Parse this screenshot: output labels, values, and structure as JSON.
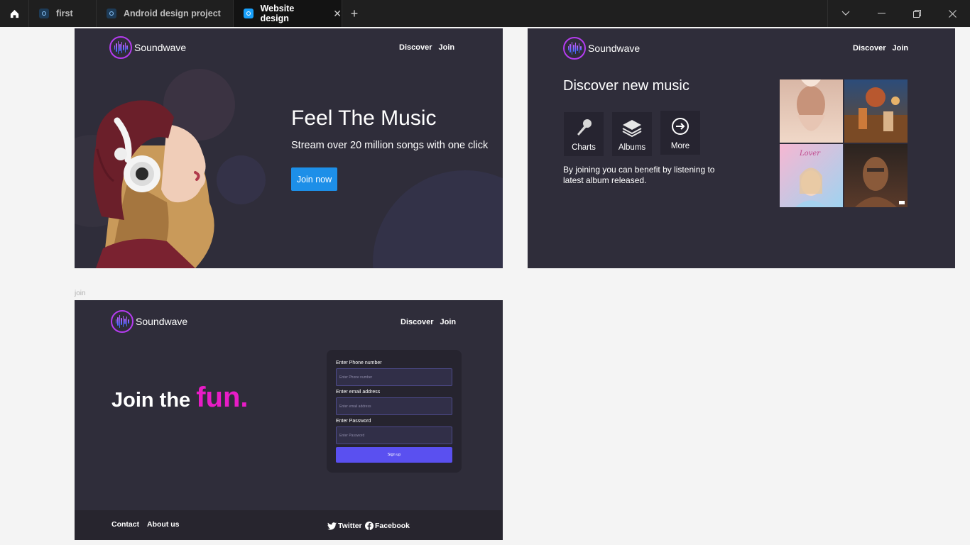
{
  "tabs": [
    {
      "label": "first"
    },
    {
      "label": "Android design project"
    },
    {
      "label": "Website design"
    }
  ],
  "new_tab_label": "+",
  "icons": [
    "home-icon",
    "file-icon",
    "close-icon",
    "chevron-down-icon",
    "minimize-icon",
    "restore-icon",
    "window-close-icon",
    "microphone-icon",
    "layers-icon",
    "arrow-right-circle-icon",
    "twitter-icon",
    "facebook-icon"
  ],
  "brand": {
    "name": "Soundwave",
    "accent": "#b53cf0"
  },
  "nav": {
    "discover": "Discover",
    "join": "Join"
  },
  "hero": {
    "title": "Feel The Music",
    "subtitle": "Stream over 20 million songs with one click",
    "cta": "Join now",
    "cta_color": "#1d8fe8"
  },
  "discover": {
    "title": "Discover new music",
    "categories": [
      {
        "label": "Charts"
      },
      {
        "label": "Albums"
      },
      {
        "label": "More"
      }
    ],
    "note": "By joining you can benefit by listening to latest album released.",
    "album_caption": "Lover"
  },
  "join_frame_label": "join",
  "join": {
    "headline": "Join the",
    "headline_accent": "fun.",
    "accent_color": "#e81cc6",
    "phone_label": "Enter  Phone number",
    "phone_placeholder": "Enter Phone number",
    "email_label": "Enter email address",
    "email_placeholder": "Enter email address",
    "password_label": "Enter  Password",
    "password_placeholder": "Enter Password",
    "signup": "Sign up",
    "signup_color": "#5a50f0"
  },
  "footer": {
    "contact": "Contact",
    "about": "About us",
    "twitter": "Twitter",
    "facebook": "Facebook"
  }
}
